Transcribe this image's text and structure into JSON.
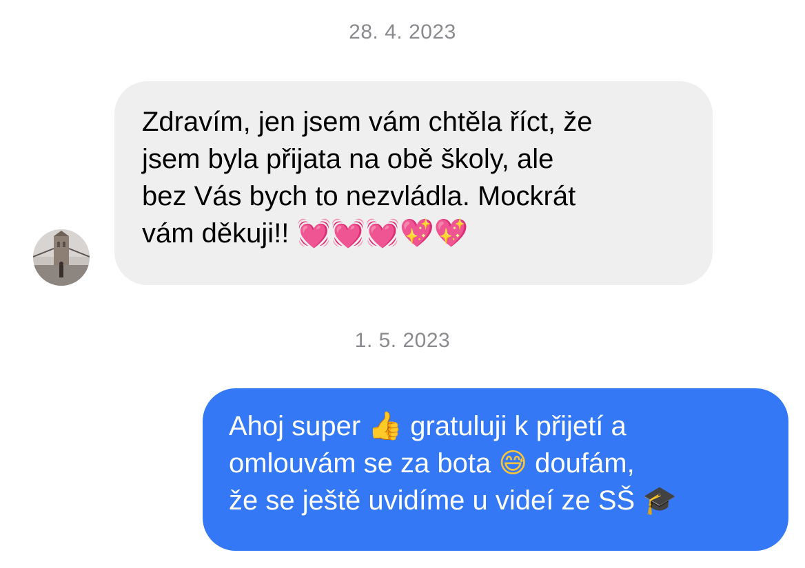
{
  "conversation": {
    "date_1": "28. 4. 2023",
    "date_2": "1. 5. 2023",
    "incoming_message": {
      "line_1": "Zdravím, jen jsem vám chtěla říct, že",
      "line_2": "jsem byla přijata na obě školy, ale",
      "line_3": "bez Vás bych to nezvládla. Mockrát",
      "line_4_text": "vám děkuji!!",
      "line_4_emoji": "💓💓💓💖💖"
    },
    "outgoing_message": {
      "line_1_a": "Ahoj super",
      "line_1_emoji": "👍",
      "line_1_b": "gratuluji k přijetí a",
      "line_2_a": "omlouvám se za bota",
      "line_2_emoji": "😅",
      "line_2_b": "doufám,",
      "line_3_a": "že se ještě uvidíme u videí ze SŠ",
      "line_3_emoji": "🎓"
    }
  },
  "colors": {
    "incoming_bubble": "#efefef",
    "outgoing_bubble": "#3478f6",
    "date_text": "#8a8a8e"
  },
  "icons": {
    "avatar": "profile-photo-bridge"
  }
}
